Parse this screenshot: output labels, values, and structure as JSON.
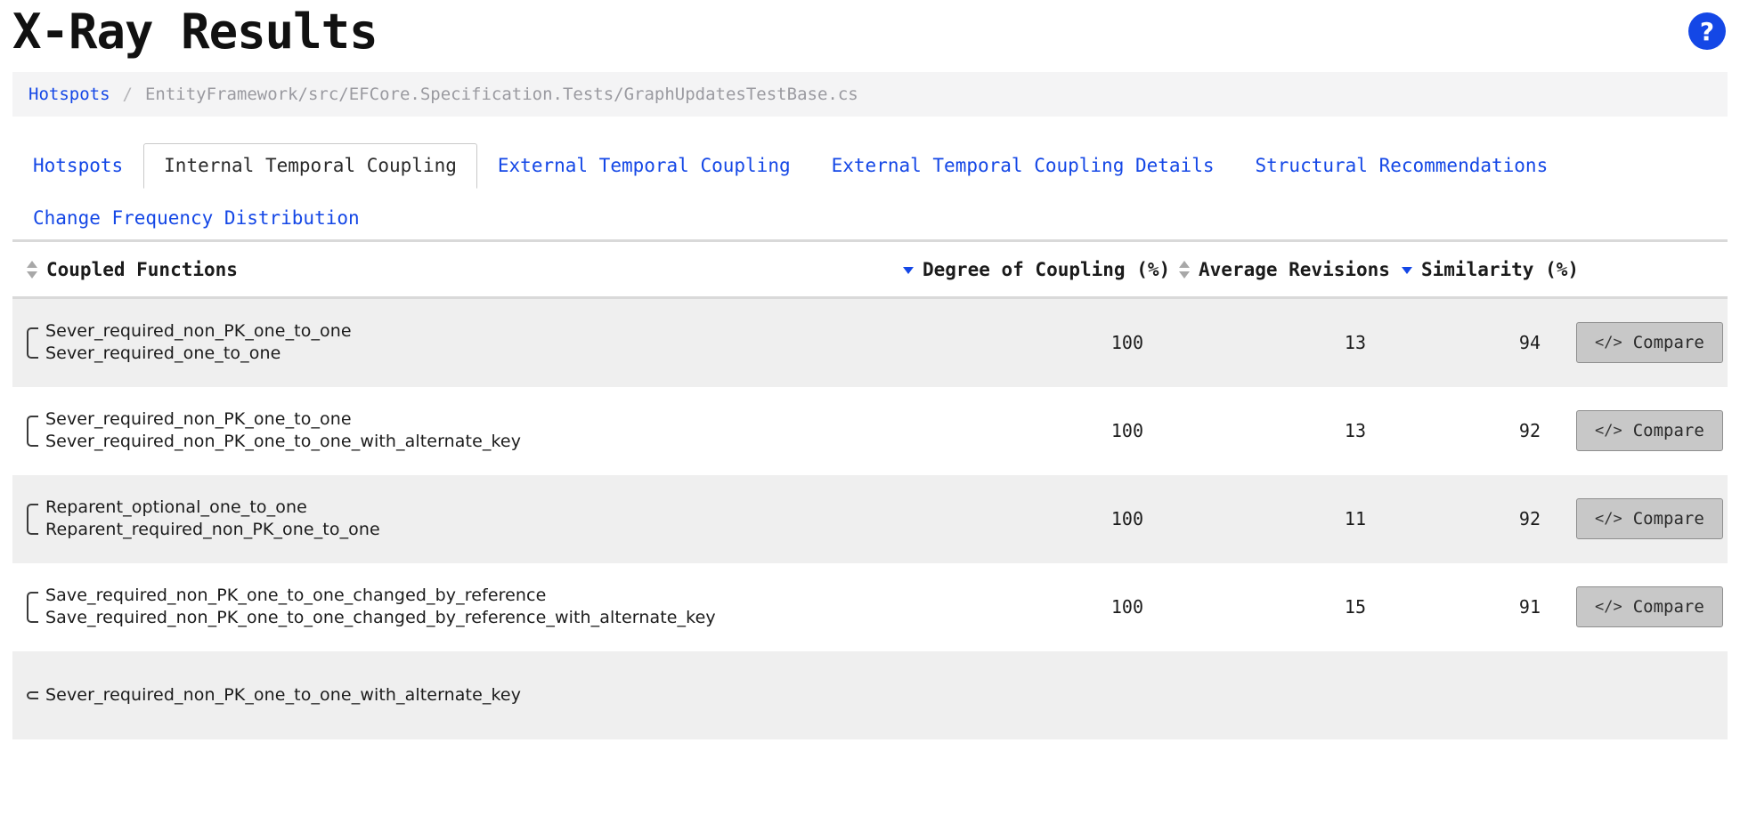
{
  "header": {
    "title": "X-Ray Results",
    "help_icon_label": "?",
    "help_icon_name": "help-icon",
    "accent_blue": "#1447e6"
  },
  "breadcrumb": {
    "link": "Hotspots",
    "separator": "/",
    "path": "EntityFramework/src/EFCore.Specification.Tests/GraphUpdatesTestBase.cs"
  },
  "tabs": [
    {
      "label": "Hotspots",
      "active": false
    },
    {
      "label": "Internal Temporal Coupling",
      "active": true
    },
    {
      "label": "External Temporal Coupling",
      "active": false
    },
    {
      "label": "External Temporal Coupling Details",
      "active": false
    },
    {
      "label": "Structural Recommendations",
      "active": false
    },
    {
      "label": "Change Frequency Distribution",
      "active": false
    }
  ],
  "table": {
    "columns": [
      {
        "label": "Coupled Functions",
        "sort": "both"
      },
      {
        "label": "Degree of Coupling (%)",
        "sort": "desc"
      },
      {
        "label": "Average Revisions",
        "sort": "both"
      },
      {
        "label": "Similarity (%)",
        "sort": "desc"
      }
    ],
    "compare_label": "Compare",
    "compare_icon": "</>",
    "rows": [
      {
        "function_a": "Sever_required_non_PK_one_to_one",
        "function_b": "Sever_required_one_to_one",
        "degree_of_coupling": "100",
        "average_revisions": "13",
        "similarity": "94"
      },
      {
        "function_a": "Sever_required_non_PK_one_to_one",
        "function_b": "Sever_required_non_PK_one_to_one_with_alternate_key",
        "degree_of_coupling": "100",
        "average_revisions": "13",
        "similarity": "92"
      },
      {
        "function_a": "Reparent_optional_one_to_one",
        "function_b": "Reparent_required_non_PK_one_to_one",
        "degree_of_coupling": "100",
        "average_revisions": "11",
        "similarity": "92"
      },
      {
        "function_a": "Save_required_non_PK_one_to_one_changed_by_reference",
        "function_b": "Save_required_non_PK_one_to_one_changed_by_reference_with_alternate_key",
        "degree_of_coupling": "100",
        "average_revisions": "15",
        "similarity": "91"
      },
      {
        "function_a": "Sever_required_non_PK_one_to_one_with_alternate_key",
        "function_b": "",
        "degree_of_coupling": "",
        "average_revisions": "",
        "similarity": ""
      }
    ]
  }
}
